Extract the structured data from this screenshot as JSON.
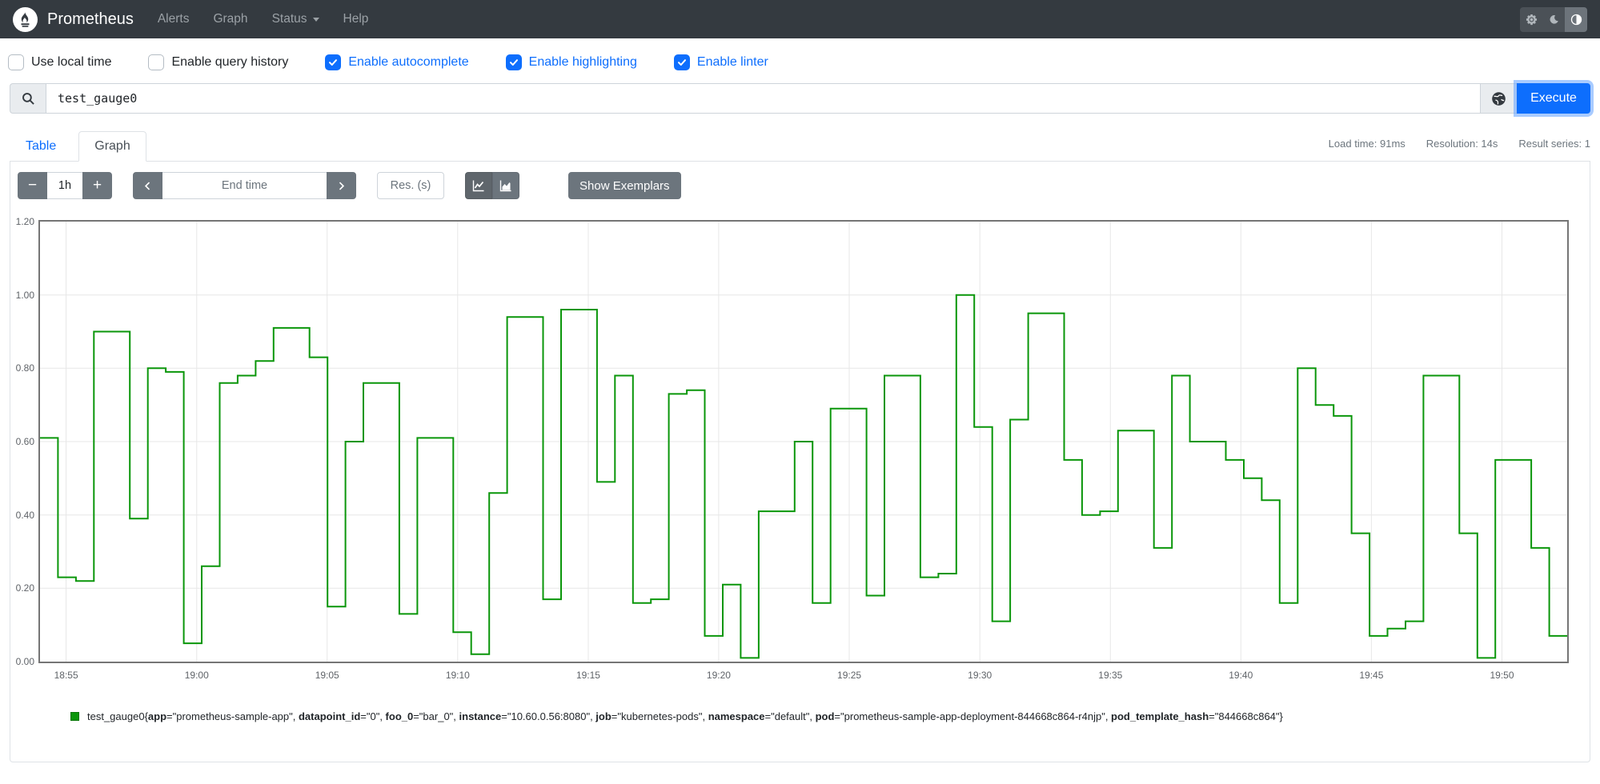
{
  "navbar": {
    "brand": "Prometheus",
    "items": [
      {
        "label": "Alerts",
        "has_caret": false
      },
      {
        "label": "Graph",
        "has_caret": false
      },
      {
        "label": "Status",
        "has_caret": true
      },
      {
        "label": "Help",
        "has_caret": false
      }
    ],
    "theme_toggle": {
      "options": [
        "light",
        "dark",
        "auto"
      ],
      "active": "auto"
    },
    "bg_color": "#343a40"
  },
  "settings": {
    "checkboxes": [
      {
        "label": "Use local time",
        "checked": false
      },
      {
        "label": "Enable query history",
        "checked": false
      },
      {
        "label": "Enable autocomplete",
        "checked": true
      },
      {
        "label": "Enable highlighting",
        "checked": true
      },
      {
        "label": "Enable linter",
        "checked": true
      }
    ],
    "checked_color": "#0d6efd"
  },
  "query": {
    "value": "test_gauge0",
    "execute_label": "Execute"
  },
  "tabs": [
    {
      "label": "Table",
      "active": false
    },
    {
      "label": "Graph",
      "active": true
    }
  ],
  "stats": {
    "load_time": "Load time: 91ms",
    "resolution": "Resolution: 14s",
    "result_series": "Result series: 1"
  },
  "controls": {
    "range_decrease": "−",
    "range_value": "1h",
    "range_increase": "+",
    "end_time_placeholder": "End time",
    "res_placeholder": "Res. (s)",
    "show_exemplars": "Show Exemplars"
  },
  "chart_data": {
    "type": "line",
    "line_style": "step",
    "color": "#0a960a",
    "title": "",
    "xlabel": "",
    "ylabel": "",
    "ylim": [
      0,
      1.2
    ],
    "grid": true,
    "y_ticks": [
      "0.00",
      "0.20",
      "0.40",
      "0.60",
      "0.80",
      "1.00",
      "1.20"
    ],
    "x_ticks": [
      {
        "label": "18:55",
        "frac": 0.0171
      },
      {
        "label": "19:00",
        "frac": 0.1026
      },
      {
        "label": "19:05",
        "frac": 0.188
      },
      {
        "label": "19:10",
        "frac": 0.2735
      },
      {
        "label": "19:15",
        "frac": 0.359
      },
      {
        "label": "19:20",
        "frac": 0.4444
      },
      {
        "label": "19:25",
        "frac": 0.5299
      },
      {
        "label": "19:30",
        "frac": 0.6154
      },
      {
        "label": "19:35",
        "frac": 0.7009
      },
      {
        "label": "19:40",
        "frac": 0.7863
      },
      {
        "label": "19:45",
        "frac": 0.8718
      },
      {
        "label": "19:50",
        "frac": 0.9573
      }
    ],
    "x_range": [
      "18:54",
      "19:52"
    ],
    "series": [
      {
        "name": "test_gauge0{app=\"prometheus-sample-app\", datapoint_id=\"0\", foo_0=\"bar_0\", instance=\"10.60.0.56:8080\", job=\"kubernetes-pods\", namespace=\"default\", pod=\"prometheus-sample-app-deployment-844668c864-r4njp\", pod_template_hash=\"844668c864\"}",
        "values": [
          0.61,
          0.23,
          0.22,
          0.9,
          0.9,
          0.39,
          0.8,
          0.79,
          0.05,
          0.26,
          0.76,
          0.78,
          0.82,
          0.91,
          0.91,
          0.83,
          0.15,
          0.6,
          0.76,
          0.76,
          0.13,
          0.61,
          0.61,
          0.08,
          0.02,
          0.46,
          0.94,
          0.94,
          0.17,
          0.96,
          0.96,
          0.49,
          0.78,
          0.16,
          0.17,
          0.73,
          0.74,
          0.07,
          0.21,
          0.01,
          0.41,
          0.41,
          0.6,
          0.16,
          0.69,
          0.69,
          0.18,
          0.78,
          0.78,
          0.23,
          0.24,
          1.0,
          0.64,
          0.11,
          0.66,
          0.95,
          0.95,
          0.55,
          0.4,
          0.41,
          0.63,
          0.63,
          0.31,
          0.78,
          0.6,
          0.6,
          0.55,
          0.5,
          0.44,
          0.16,
          0.8,
          0.7,
          0.67,
          0.35,
          0.07,
          0.09,
          0.11,
          0.78,
          0.78,
          0.35,
          0.01,
          0.55,
          0.55,
          0.31,
          0.07
        ]
      }
    ]
  },
  "legend": {
    "metric": "test_gauge0",
    "labels": [
      {
        "name": "app",
        "value": "prometheus-sample-app"
      },
      {
        "name": "datapoint_id",
        "value": "0"
      },
      {
        "name": "foo_0",
        "value": "bar_0"
      },
      {
        "name": "instance",
        "value": "10.60.0.56:8080"
      },
      {
        "name": "job",
        "value": "kubernetes-pods"
      },
      {
        "name": "namespace",
        "value": "default"
      },
      {
        "name": "pod",
        "value": "prometheus-sample-app-deployment-844668c864-r4njp"
      },
      {
        "name": "pod_template_hash",
        "value": "844668c864"
      }
    ]
  }
}
